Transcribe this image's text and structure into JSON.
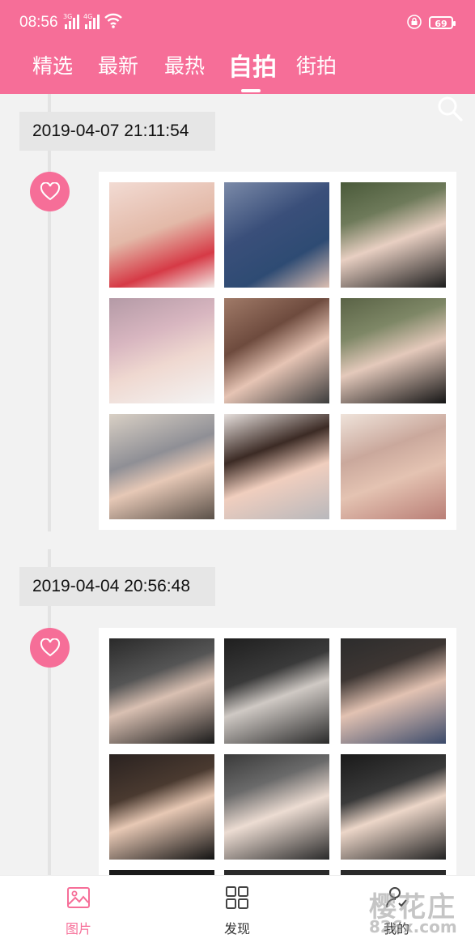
{
  "status_bar": {
    "time": "08:56",
    "signal1_label": "3G",
    "signal2_label": "4G",
    "battery": "69"
  },
  "tabs": [
    {
      "label": "精选"
    },
    {
      "label": "最新"
    },
    {
      "label": "最热"
    },
    {
      "label": "自拍"
    },
    {
      "label": "街拍"
    }
  ],
  "active_tab": "自拍",
  "posts": [
    {
      "date": "2019-04-07 21:11:54"
    },
    {
      "date": "2019-04-04 20:56:48"
    }
  ],
  "bottom_nav": [
    {
      "label": "图片",
      "icon": "picture-icon"
    },
    {
      "label": "发现",
      "icon": "grid-icon"
    },
    {
      "label": "我的",
      "icon": "user-icon"
    }
  ],
  "watermark": {
    "text": "樱花庄",
    "sub": "826x.com"
  },
  "colors": {
    "accent": "#f66e98",
    "background": "#f2f2f2",
    "date_bg": "#e6e6e6"
  }
}
